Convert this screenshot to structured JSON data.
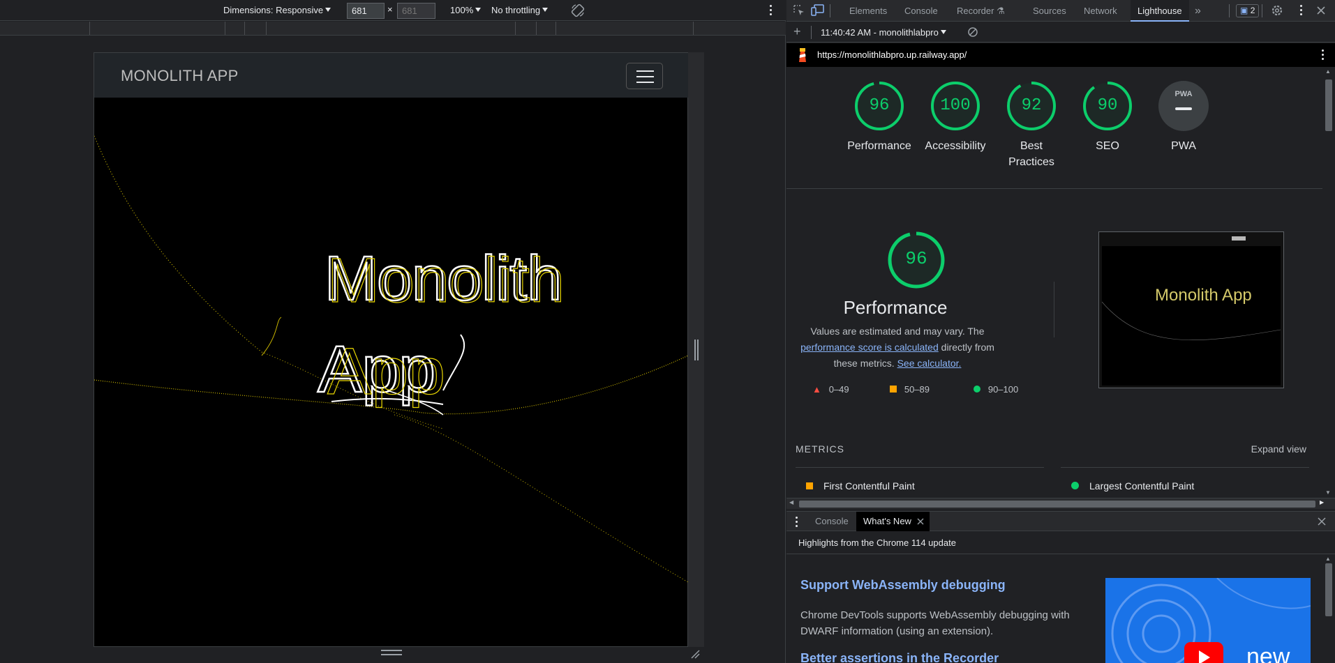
{
  "device_toolbar": {
    "dimensions_label": "Dimensions: Responsive",
    "width_value": "681",
    "height_placeholder": "681",
    "times": "×",
    "zoom": "100%",
    "throttling": "No throttling"
  },
  "site": {
    "brand": "MONOLITH APP",
    "hero_line1": "Monolith",
    "hero_line2": "App"
  },
  "devtools": {
    "tabs": [
      "Elements",
      "Console",
      "Recorder",
      "Sources",
      "Network",
      "Lighthouse"
    ],
    "active_tab": "Lighthouse",
    "issues_count": "2",
    "report_select": "11:40:42 AM - monolithlabpro",
    "url": "https://monolithlabpro.up.railway.app/"
  },
  "scores": [
    {
      "label": "Performance",
      "value": "96",
      "fraction": 0.96
    },
    {
      "label": "Accessibility",
      "value": "100",
      "fraction": 1.0
    },
    {
      "label": "Best Practices",
      "value": "92",
      "fraction": 0.92
    },
    {
      "label": "SEO",
      "value": "90",
      "fraction": 0.9
    },
    {
      "label": "PWA",
      "value": "—",
      "fraction": 0
    }
  ],
  "performance": {
    "score": "96",
    "title": "Performance",
    "desc_1": "Values are estimated and may vary. The ",
    "desc_link1": "performance score is calculated",
    "desc_2": " directly from these metrics. ",
    "desc_link2": "See calculator.",
    "legend": [
      {
        "range": "0–49",
        "color": "#ff4e42",
        "shape": "triangle"
      },
      {
        "range": "50–89",
        "color": "#ffa400",
        "shape": "square"
      },
      {
        "range": "90–100",
        "color": "#0cce6b",
        "shape": "circle"
      }
    ],
    "thumb_text": "Monolith App"
  },
  "metrics": {
    "heading": "METRICS",
    "expand": "Expand view",
    "items": [
      {
        "label": "First Contentful Paint",
        "color": "#ffa400"
      },
      {
        "label": "Largest Contentful Paint",
        "color": "#0cce6b"
      }
    ]
  },
  "drawer": {
    "tabs": [
      "Console",
      "What's New"
    ],
    "active": "What's New",
    "highlights": "Highlights from the Chrome 114 update",
    "item1_title": "Support WebAssembly debugging",
    "item1_text": "Chrome DevTools supports WebAssembly debugging with DWARF information (using an extension).",
    "item2_title": "Better assertions in the Recorder",
    "img_text": "new"
  },
  "colors": {
    "pass": "#0cce6b",
    "average": "#ffa400",
    "fail": "#ff4e42",
    "link": "#8ab4f8"
  }
}
